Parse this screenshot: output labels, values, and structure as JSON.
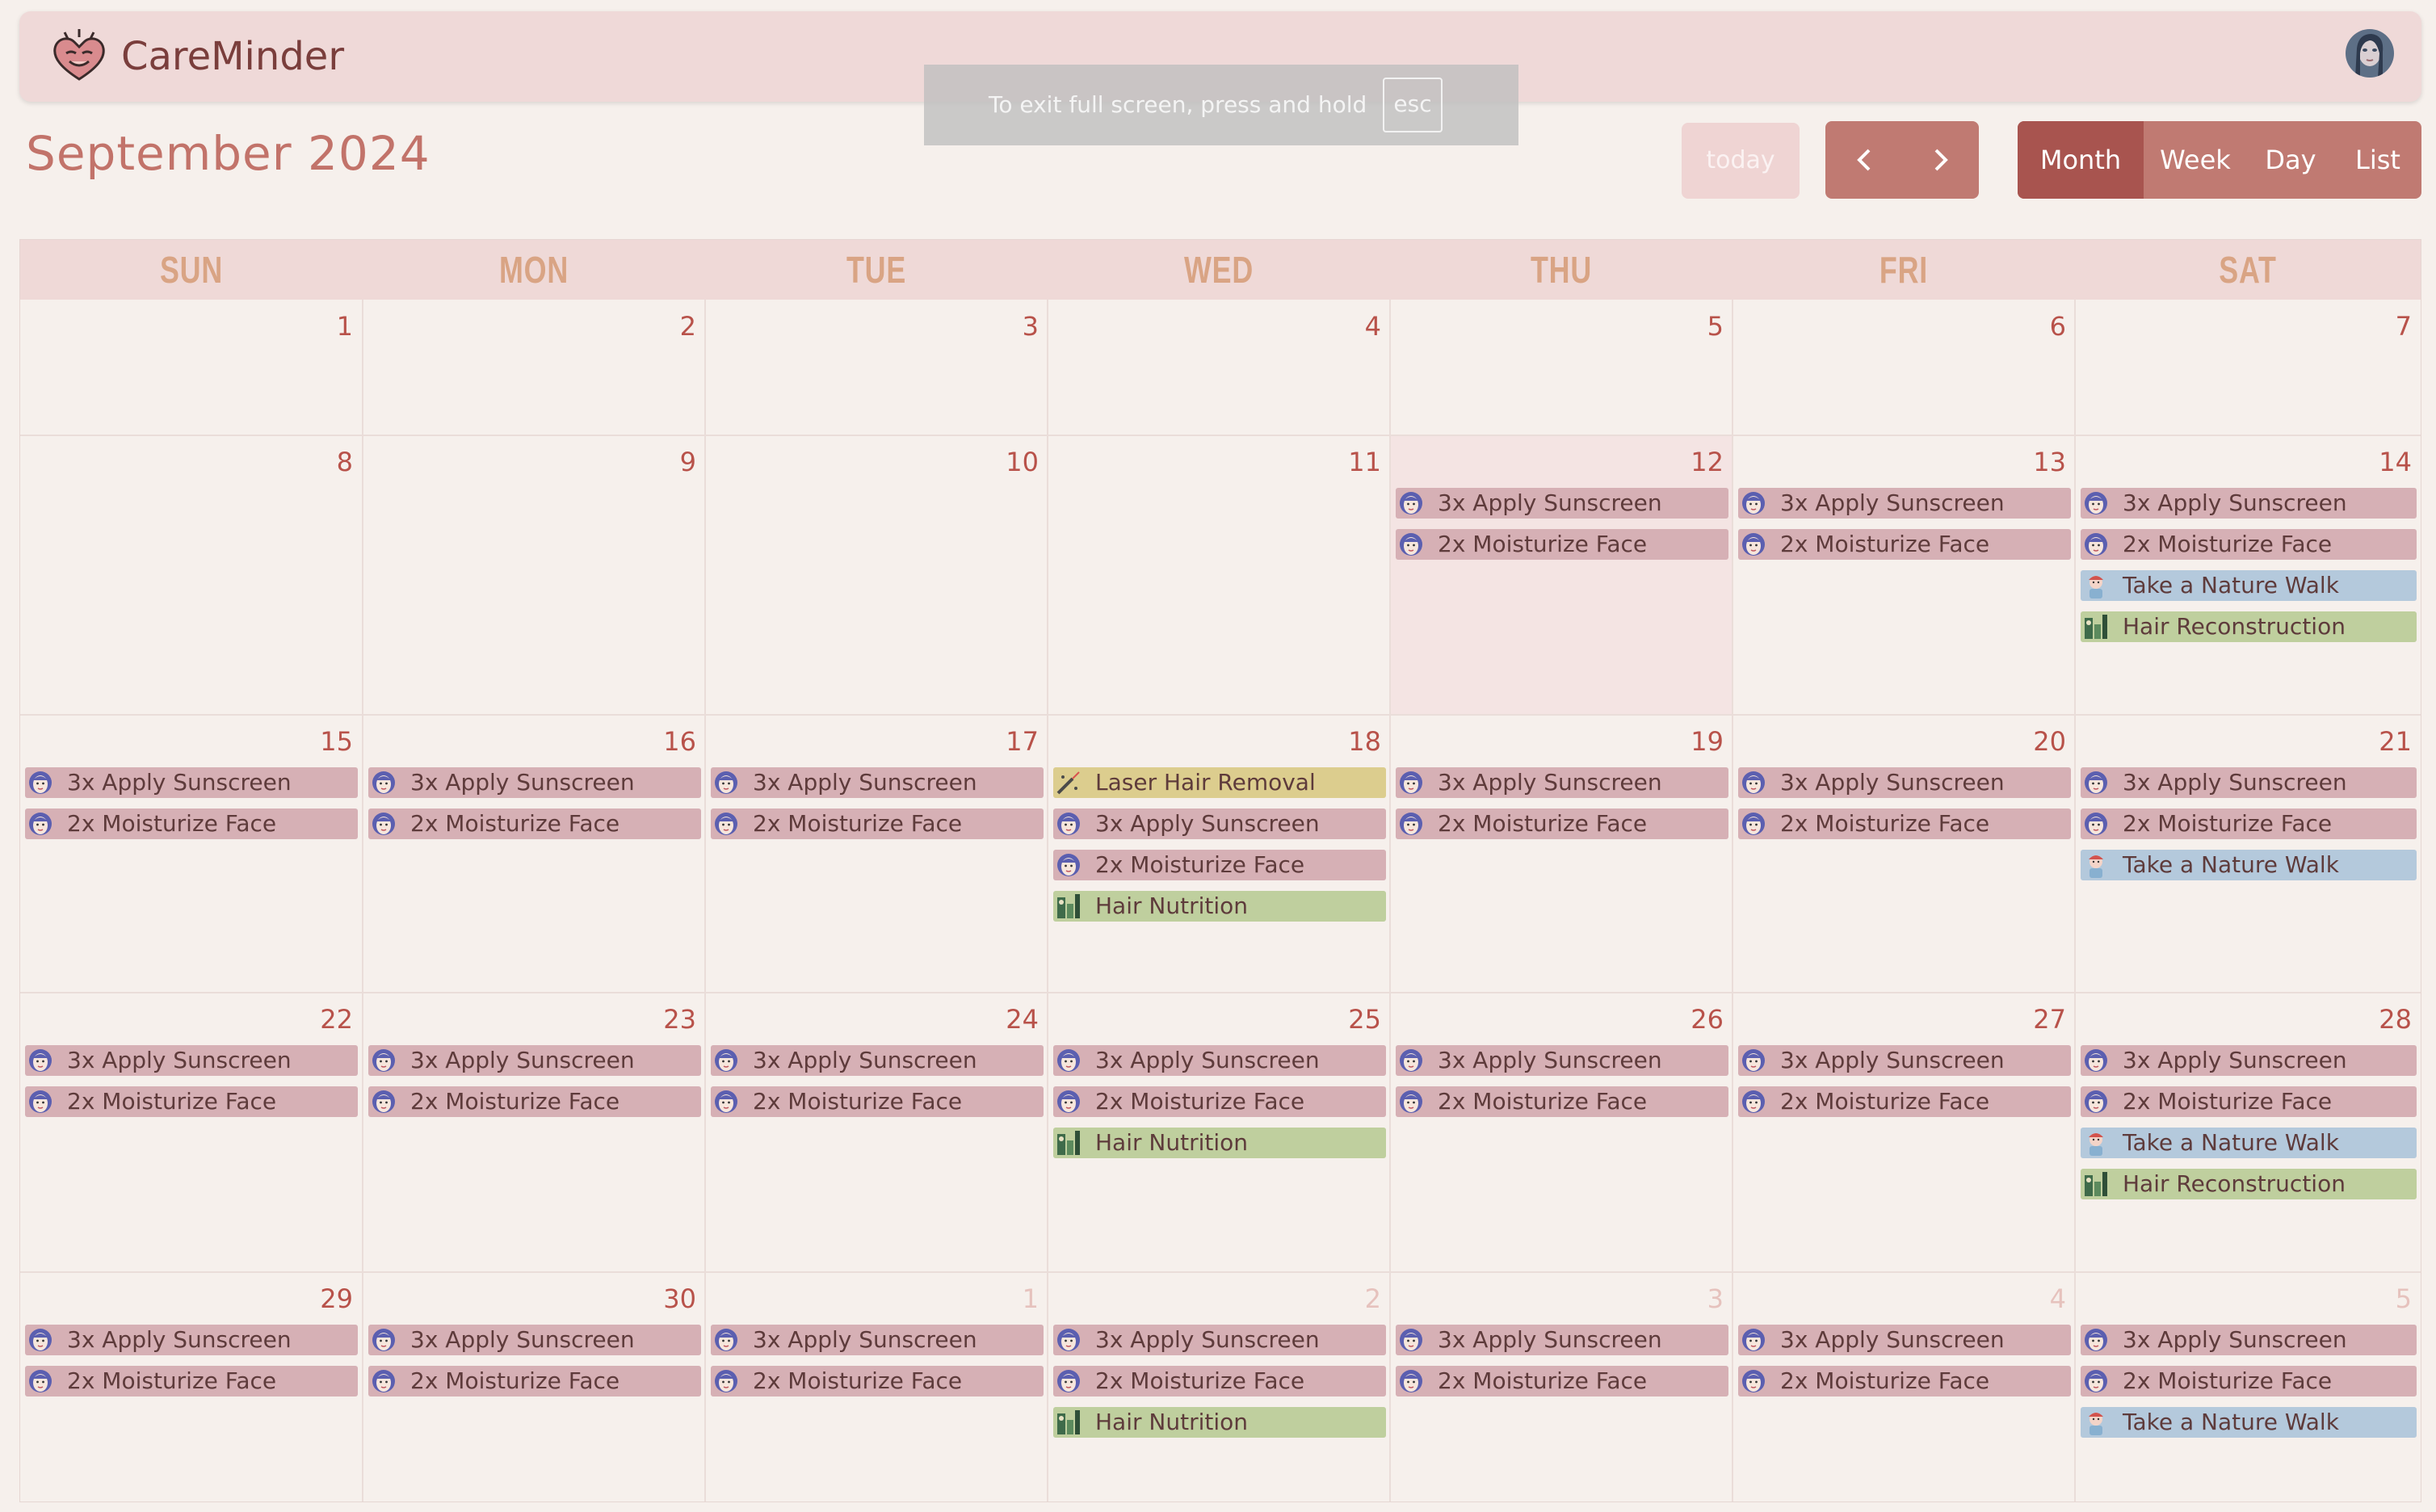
{
  "app": {
    "title": "CareMinder"
  },
  "toast": {
    "message": "To exit full screen, press and hold",
    "key": "esc"
  },
  "header": {
    "month_title": "September 2024"
  },
  "toolbar": {
    "today_label": "today",
    "prev_icon": "chevron-left-icon",
    "next_icon": "chevron-right-icon",
    "views": [
      "Month",
      "Week",
      "Day",
      "List"
    ],
    "active_view": "Month"
  },
  "colors": {
    "primary": "#c07a72",
    "active": "#a8544f",
    "sunscreen_event": "#d6b0b5",
    "walk_event": "#b4c9dc",
    "hair_event": "#bfcf9e",
    "laser_event": "#dccd8e"
  },
  "calendar": {
    "weekdays": [
      "SUN",
      "MON",
      "TUE",
      "WED",
      "THU",
      "FRI",
      "SAT"
    ],
    "weeks": [
      [
        {
          "day": "1",
          "events": []
        },
        {
          "day": "2",
          "events": []
        },
        {
          "day": "3",
          "events": []
        },
        {
          "day": "4",
          "events": []
        },
        {
          "day": "5",
          "events": []
        },
        {
          "day": "6",
          "events": []
        },
        {
          "day": "7",
          "events": []
        }
      ],
      [
        {
          "day": "8",
          "events": []
        },
        {
          "day": "9",
          "events": []
        },
        {
          "day": "10",
          "events": []
        },
        {
          "day": "11",
          "events": []
        },
        {
          "day": "12",
          "today": true,
          "events": [
            {
              "label": "3x Apply Sunscreen",
              "kind": "sun",
              "icon": "sunscreen-face-icon"
            },
            {
              "label": "2x Moisturize Face",
              "kind": "moist",
              "icon": "moisturize-face-icon"
            }
          ]
        },
        {
          "day": "13",
          "events": [
            {
              "label": "3x Apply Sunscreen",
              "kind": "sun",
              "icon": "sunscreen-face-icon"
            },
            {
              "label": "2x Moisturize Face",
              "kind": "moist",
              "icon": "moisturize-face-icon"
            }
          ]
        },
        {
          "day": "14",
          "events": [
            {
              "label": "3x Apply Sunscreen",
              "kind": "sun",
              "icon": "sunscreen-face-icon"
            },
            {
              "label": "2x Moisturize Face",
              "kind": "moist",
              "icon": "moisturize-face-icon"
            },
            {
              "label": "Take a Nature Walk",
              "kind": "walk",
              "icon": "nature-walk-icon"
            },
            {
              "label": "Hair Reconstruction",
              "kind": "hair",
              "icon": "hair-care-icon"
            }
          ]
        }
      ],
      [
        {
          "day": "15",
          "events": [
            {
              "label": "3x Apply Sunscreen",
              "kind": "sun",
              "icon": "sunscreen-face-icon"
            },
            {
              "label": "2x Moisturize Face",
              "kind": "moist",
              "icon": "moisturize-face-icon"
            }
          ]
        },
        {
          "day": "16",
          "events": [
            {
              "label": "3x Apply Sunscreen",
              "kind": "sun",
              "icon": "sunscreen-face-icon"
            },
            {
              "label": "2x Moisturize Face",
              "kind": "moist",
              "icon": "moisturize-face-icon"
            }
          ]
        },
        {
          "day": "17",
          "events": [
            {
              "label": "3x Apply Sunscreen",
              "kind": "sun",
              "icon": "sunscreen-face-icon"
            },
            {
              "label": "2x Moisturize Face",
              "kind": "moist",
              "icon": "moisturize-face-icon"
            }
          ]
        },
        {
          "day": "18",
          "events": [
            {
              "label": "Laser Hair Removal",
              "kind": "laser",
              "icon": "laser-icon"
            },
            {
              "label": "3x Apply Sunscreen",
              "kind": "sun",
              "icon": "sunscreen-face-icon"
            },
            {
              "label": "2x Moisturize Face",
              "kind": "moist",
              "icon": "moisturize-face-icon"
            },
            {
              "label": "Hair Nutrition",
              "kind": "hair",
              "icon": "hair-care-icon"
            }
          ]
        },
        {
          "day": "19",
          "events": [
            {
              "label": "3x Apply Sunscreen",
              "kind": "sun",
              "icon": "sunscreen-face-icon"
            },
            {
              "label": "2x Moisturize Face",
              "kind": "moist",
              "icon": "moisturize-face-icon"
            }
          ]
        },
        {
          "day": "20",
          "events": [
            {
              "label": "3x Apply Sunscreen",
              "kind": "sun",
              "icon": "sunscreen-face-icon"
            },
            {
              "label": "2x Moisturize Face",
              "kind": "moist",
              "icon": "moisturize-face-icon"
            }
          ]
        },
        {
          "day": "21",
          "events": [
            {
              "label": "3x Apply Sunscreen",
              "kind": "sun",
              "icon": "sunscreen-face-icon"
            },
            {
              "label": "2x Moisturize Face",
              "kind": "moist",
              "icon": "moisturize-face-icon"
            },
            {
              "label": "Take a Nature Walk",
              "kind": "walk",
              "icon": "nature-walk-icon"
            }
          ]
        }
      ],
      [
        {
          "day": "22",
          "events": [
            {
              "label": "3x Apply Sunscreen",
              "kind": "sun",
              "icon": "sunscreen-face-icon"
            },
            {
              "label": "2x Moisturize Face",
              "kind": "moist",
              "icon": "moisturize-face-icon"
            }
          ]
        },
        {
          "day": "23",
          "events": [
            {
              "label": "3x Apply Sunscreen",
              "kind": "sun",
              "icon": "sunscreen-face-icon"
            },
            {
              "label": "2x Moisturize Face",
              "kind": "moist",
              "icon": "moisturize-face-icon"
            }
          ]
        },
        {
          "day": "24",
          "events": [
            {
              "label": "3x Apply Sunscreen",
              "kind": "sun",
              "icon": "sunscreen-face-icon"
            },
            {
              "label": "2x Moisturize Face",
              "kind": "moist",
              "icon": "moisturize-face-icon"
            }
          ]
        },
        {
          "day": "25",
          "events": [
            {
              "label": "3x Apply Sunscreen",
              "kind": "sun",
              "icon": "sunscreen-face-icon"
            },
            {
              "label": "2x Moisturize Face",
              "kind": "moist",
              "icon": "moisturize-face-icon"
            },
            {
              "label": "Hair Nutrition",
              "kind": "hair",
              "icon": "hair-care-icon"
            }
          ]
        },
        {
          "day": "26",
          "events": [
            {
              "label": "3x Apply Sunscreen",
              "kind": "sun",
              "icon": "sunscreen-face-icon"
            },
            {
              "label": "2x Moisturize Face",
              "kind": "moist",
              "icon": "moisturize-face-icon"
            }
          ]
        },
        {
          "day": "27",
          "events": [
            {
              "label": "3x Apply Sunscreen",
              "kind": "sun",
              "icon": "sunscreen-face-icon"
            },
            {
              "label": "2x Moisturize Face",
              "kind": "moist",
              "icon": "moisturize-face-icon"
            }
          ]
        },
        {
          "day": "28",
          "events": [
            {
              "label": "3x Apply Sunscreen",
              "kind": "sun",
              "icon": "sunscreen-face-icon"
            },
            {
              "label": "2x Moisturize Face",
              "kind": "moist",
              "icon": "moisturize-face-icon"
            },
            {
              "label": "Take a Nature Walk",
              "kind": "walk",
              "icon": "nature-walk-icon"
            },
            {
              "label": "Hair Reconstruction",
              "kind": "hair",
              "icon": "hair-care-icon"
            }
          ]
        }
      ],
      [
        {
          "day": "29",
          "events": [
            {
              "label": "3x Apply Sunscreen",
              "kind": "sun",
              "icon": "sunscreen-face-icon"
            },
            {
              "label": "2x Moisturize Face",
              "kind": "moist",
              "icon": "moisturize-face-icon"
            }
          ]
        },
        {
          "day": "30",
          "events": [
            {
              "label": "3x Apply Sunscreen",
              "kind": "sun",
              "icon": "sunscreen-face-icon"
            },
            {
              "label": "2x Moisturize Face",
              "kind": "moist",
              "icon": "moisturize-face-icon"
            }
          ]
        },
        {
          "day": "1",
          "other_month": true,
          "events": [
            {
              "label": "3x Apply Sunscreen",
              "kind": "sun",
              "icon": "sunscreen-face-icon"
            },
            {
              "label": "2x Moisturize Face",
              "kind": "moist",
              "icon": "moisturize-face-icon"
            }
          ]
        },
        {
          "day": "2",
          "other_month": true,
          "events": [
            {
              "label": "3x Apply Sunscreen",
              "kind": "sun",
              "icon": "sunscreen-face-icon"
            },
            {
              "label": "2x Moisturize Face",
              "kind": "moist",
              "icon": "moisturize-face-icon"
            },
            {
              "label": "Hair Nutrition",
              "kind": "hair",
              "icon": "hair-care-icon"
            }
          ]
        },
        {
          "day": "3",
          "other_month": true,
          "events": [
            {
              "label": "3x Apply Sunscreen",
              "kind": "sun",
              "icon": "sunscreen-face-icon"
            },
            {
              "label": "2x Moisturize Face",
              "kind": "moist",
              "icon": "moisturize-face-icon"
            }
          ]
        },
        {
          "day": "4",
          "other_month": true,
          "events": [
            {
              "label": "3x Apply Sunscreen",
              "kind": "sun",
              "icon": "sunscreen-face-icon"
            },
            {
              "label": "2x Moisturize Face",
              "kind": "moist",
              "icon": "moisturize-face-icon"
            }
          ]
        },
        {
          "day": "5",
          "other_month": true,
          "events": [
            {
              "label": "3x Apply Sunscreen",
              "kind": "sun",
              "icon": "sunscreen-face-icon"
            },
            {
              "label": "2x Moisturize Face",
              "kind": "moist",
              "icon": "moisturize-face-icon"
            },
            {
              "label": "Take a Nature Walk",
              "kind": "walk",
              "icon": "nature-walk-icon"
            }
          ]
        }
      ]
    ]
  }
}
